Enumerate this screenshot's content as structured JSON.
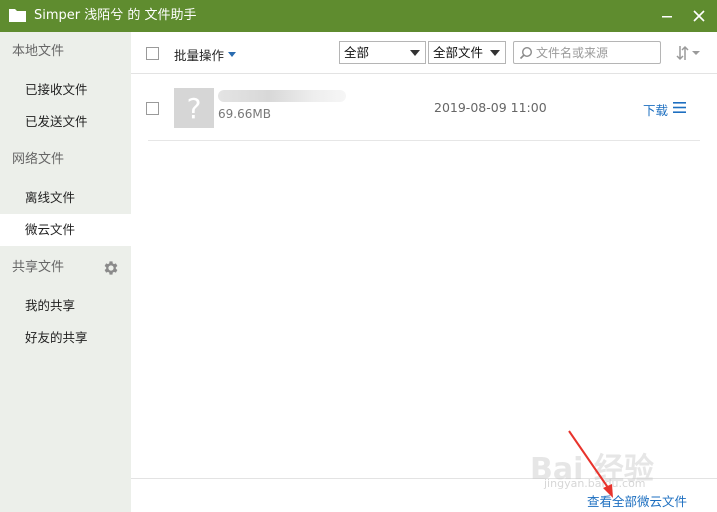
{
  "window": {
    "title": "Simper 浅陌兮 的 文件助手"
  },
  "sidebar": {
    "sections": [
      {
        "header": "本地文件",
        "items": [
          "已接收文件",
          "已发送文件"
        ]
      },
      {
        "header": "网络文件",
        "items": [
          "离线文件",
          "微云文件"
        ]
      },
      {
        "header": "共享文件",
        "items": [
          "我的共享",
          "好友的共享"
        ]
      }
    ],
    "active_item": "微云文件"
  },
  "toolbar": {
    "batch_label": "批量操作",
    "type_filter": {
      "selected": "全部"
    },
    "file_filter": {
      "selected": "全部文件"
    },
    "search_placeholder": "文件名或来源"
  },
  "files": [
    {
      "size": "69.66MB",
      "date": "2019-08-09 11:00",
      "action": "下载",
      "thumb_glyph": "?"
    }
  ],
  "footer": {
    "view_all_label": "查看全部微云文件"
  },
  "watermark": {
    "main": "Bai 经验",
    "sub": "jingyan.baidu.com"
  },
  "colors": {
    "titlebar": "#5f8c2f",
    "sidebar_bg": "#ecefea",
    "link": "#1d6fc0",
    "annotation_arrow": "#e8332c"
  },
  "icons": {
    "app": "folder-icon",
    "minimize": "minimize-icon",
    "close": "close-icon",
    "settings": "gear-icon",
    "search": "search-icon",
    "sort": "sort-icon",
    "more": "menu-icon"
  }
}
